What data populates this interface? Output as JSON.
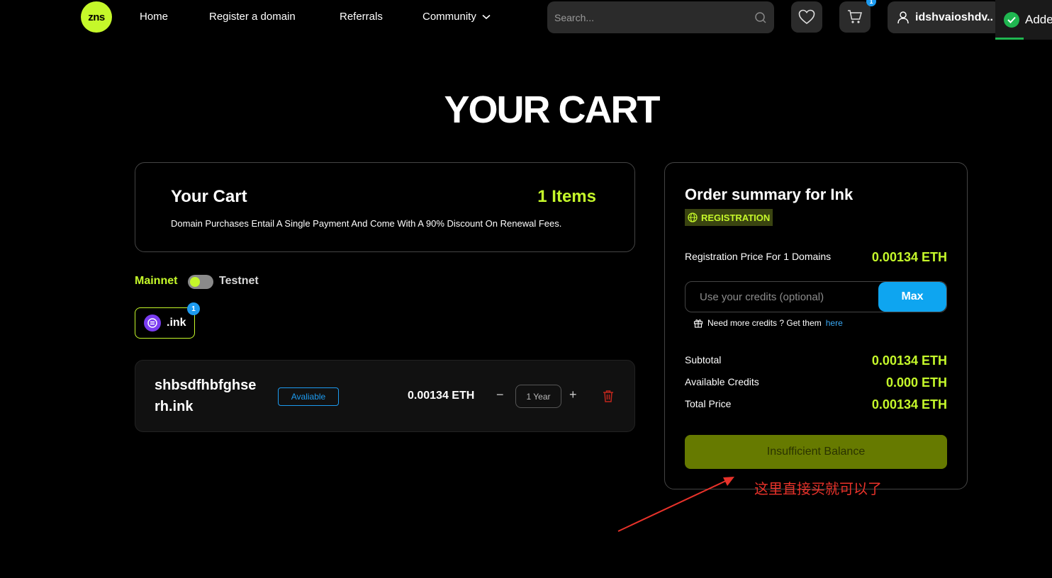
{
  "header": {
    "logo_text": "zns",
    "nav": {
      "home": "Home",
      "register": "Register a domain",
      "referrals": "Referrals",
      "community": "Community"
    },
    "search_placeholder": "Search...",
    "cart_count": "1",
    "user": "idshvaioshdv..",
    "toast": "Adde"
  },
  "page": {
    "title": "YOUR CART"
  },
  "cart": {
    "title": "Your Cart",
    "count": "1 Items",
    "note": "Domain Purchases Entail A Single Payment And Come With A 90% Discount On Renewal Fees."
  },
  "network": {
    "mainnet": "Mainnet",
    "testnet": "Testnet",
    "selected": "Mainnet"
  },
  "tld": {
    "label": ".ink",
    "badge": "1"
  },
  "item": {
    "domain": "shbsdfhbfghserh.ink",
    "status": "Avaliable",
    "price": "0.00134 ETH",
    "minus": "−",
    "years": "1 Year",
    "plus": "+"
  },
  "summary": {
    "title": "Order summary for Ink",
    "badge": "REGISTRATION",
    "reg_price_label": "Registration Price For 1 Domains",
    "reg_price_value": "0.00134 ETH",
    "credits_placeholder": "Use your credits (optional)",
    "max_label": "Max",
    "hint_text": "Need more credits ? Get them",
    "hint_link": "here",
    "subtotal_label": "Subtotal",
    "subtotal_value": "0.00134 ETH",
    "credits_label": "Available Credits",
    "credits_value": "0.000 ETH",
    "total_label": "Total Price",
    "total_value": "0.00134 ETH",
    "button_label": "Insufficient Balance"
  },
  "annotation": {
    "text": "这里直接买就可以了",
    "color": "#e8322a"
  },
  "colors": {
    "accent": "#c5f82a",
    "blue": "#1d9bf0",
    "background": "#000000"
  }
}
